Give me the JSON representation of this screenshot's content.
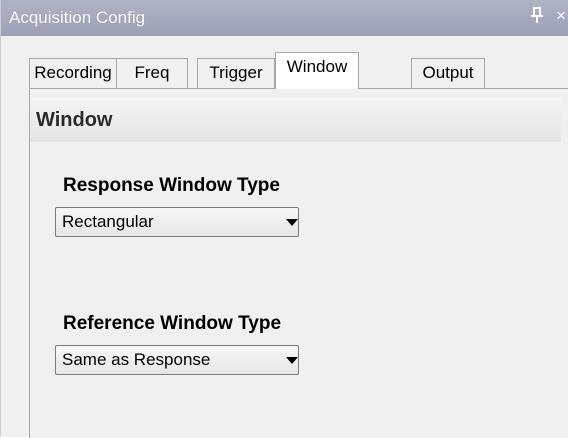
{
  "window": {
    "title": "Acquisition Config",
    "pin_icon": "pin-icon",
    "close_glyph": "×"
  },
  "tabs": [
    {
      "label": "Recording",
      "active": false
    },
    {
      "label": "Freq",
      "active": false
    },
    {
      "label": "Trigger",
      "active": false
    },
    {
      "label": "Window",
      "active": true
    },
    {
      "label": "Output",
      "active": false
    }
  ],
  "section": {
    "title": "Window"
  },
  "response": {
    "label": "Response Window Type",
    "selected": "Rectangular"
  },
  "reference": {
    "label": "Reference Window Type",
    "selected": "Same as Response"
  },
  "colors": {
    "titlebar": "#a5aabe",
    "panel_bg": "#f0f0f0",
    "active_tab": "#ffffff"
  }
}
